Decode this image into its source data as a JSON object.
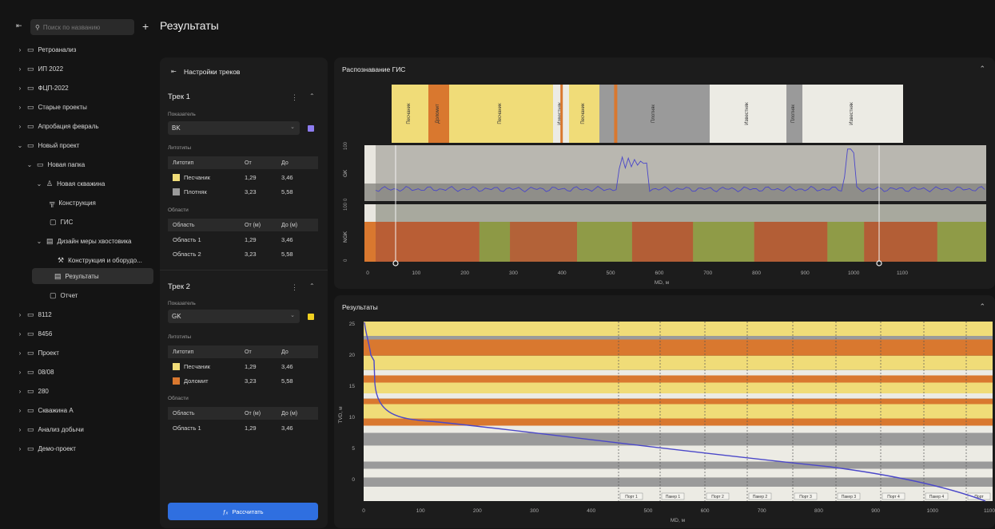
{
  "header": {
    "title": "Результаты"
  },
  "sidebar": {
    "search_placeholder": "Поиск по названию",
    "items": [
      {
        "label": "Ретроанализ"
      },
      {
        "label": "ИП 2022"
      },
      {
        "label": "ФЦП-2022"
      },
      {
        "label": "Старые проекты"
      },
      {
        "label": "Апробация февраль"
      },
      {
        "label": "Новый проект"
      },
      {
        "label": "Новая папка"
      },
      {
        "label": "Новая скважина"
      },
      {
        "label": "Конструкция"
      },
      {
        "label": "ГИС"
      },
      {
        "label": "Дизайн меры хвостовика"
      },
      {
        "label": "Конструкция и оборудо..."
      },
      {
        "label": "Результаты"
      },
      {
        "label": "Отчет"
      },
      {
        "label": "8112"
      },
      {
        "label": "8456"
      },
      {
        "label": "Проект"
      },
      {
        "label": "08/08"
      },
      {
        "label": "280"
      },
      {
        "label": "Скважина А"
      },
      {
        "label": "Анализ добычи"
      },
      {
        "label": "Демо-проект"
      }
    ]
  },
  "settings": {
    "title": "Настройки треков",
    "track1": {
      "title": "Трек 1",
      "indicator_label": "Показатель",
      "indicator_value": "BK",
      "indicator_color": "#8d7cf0",
      "litho_label": "Литотипы",
      "litho_headers": [
        "Литотип",
        "От",
        "До"
      ],
      "litho_rows": [
        {
          "name": "Песчаник",
          "from": "1,29",
          "to": "3,46",
          "color": "#f0dc78"
        },
        {
          "name": "Плотняк",
          "from": "3,23",
          "to": "5,58",
          "color": "#9a9a9a"
        }
      ],
      "areas_label": "Области",
      "area_headers": [
        "Область",
        "От (м)",
        "До (м)"
      ],
      "area_rows": [
        {
          "name": "Область 1",
          "from": "1,29",
          "to": "3,46"
        },
        {
          "name": "Область 2",
          "from": "3,23",
          "to": "5,58"
        }
      ]
    },
    "track2": {
      "title": "Трек 2",
      "indicator_label": "Показатель",
      "indicator_value": "GK",
      "indicator_color": "#f0d020",
      "litho_label": "Литотипы",
      "litho_headers": [
        "Литотип",
        "От",
        "До"
      ],
      "litho_rows": [
        {
          "name": "Песчаник",
          "from": "1,29",
          "to": "3,46",
          "color": "#f0dc78"
        },
        {
          "name": "Доломит",
          "from": "3,23",
          "to": "5,58",
          "color": "#d9782f"
        }
      ],
      "areas_label": "Области",
      "area_headers": [
        "Область",
        "От (м)",
        "До (м)"
      ],
      "area_rows": [
        {
          "name": "Область 1",
          "from": "1,29",
          "to": "3,46"
        }
      ]
    },
    "calc_button": "Рассчитать"
  },
  "gis_panel": {
    "title": "Распознавание ГИС",
    "layers": [
      {
        "label": "Песчаник",
        "color": "#f0dc78"
      },
      {
        "label": "Доломит",
        "color": "#d9782f"
      },
      {
        "label": "Песчаник",
        "color": "#f0dc78"
      },
      {
        "label": "Известняк",
        "color": "#ecebe4"
      },
      {
        "label": "Песчаник",
        "color": "#f0dc78"
      },
      {
        "label": "Плотняк",
        "color": "#9a9a9a"
      },
      {
        "label": "Известняк",
        "color": "#ecebe4"
      },
      {
        "label": "Плотняк",
        "color": "#9a9a9a"
      },
      {
        "label": "Известняк",
        "color": "#ecebe4"
      }
    ],
    "track1_label": "GK",
    "track2_label": "NGK",
    "y_top": "100",
    "y_bottom": "0",
    "x_ticks": [
      "0",
      "100",
      "200",
      "300",
      "400",
      "500",
      "600",
      "700",
      "800",
      "900",
      "1000",
      "1100"
    ],
    "x_label": "MD, м"
  },
  "results_panel": {
    "title": "Результаты",
    "y_ticks": [
      "25",
      "20",
      "15",
      "10",
      "5",
      "0"
    ],
    "y_label": "TVD, м",
    "x_ticks": [
      "0",
      "100",
      "200",
      "300",
      "400",
      "500",
      "600",
      "700",
      "800",
      "900",
      "1000",
      "1100"
    ],
    "x_label": "MD, м",
    "markers": [
      "Порт 1",
      "Пакер 1",
      "Порт 2",
      "Пакер 2",
      "Порт 3",
      "Пакер 3",
      "Порт 4",
      "Пакер 4",
      "Порт"
    ]
  }
}
